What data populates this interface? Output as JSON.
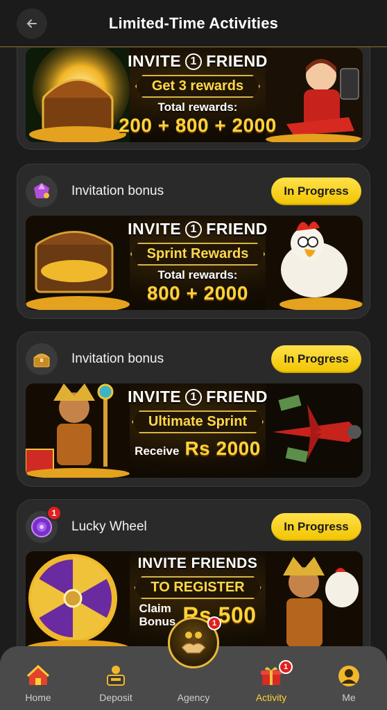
{
  "header": {
    "title": "Limited-Time Activities",
    "back_icon": "arrow-left-icon"
  },
  "cards": [
    {
      "banner": {
        "invite": "INVITE",
        "number": "1",
        "friend": "FRIEND",
        "pill": "Get 3 rewards",
        "total_label": "Total rewards:",
        "total_value": "200 + 800 + 2000"
      }
    },
    {
      "title": "Invitation bonus",
      "status": "In Progress",
      "icon": "gem-gift-icon",
      "banner": {
        "invite": "INVITE",
        "number": "1",
        "friend": "FRIEND",
        "pill": "Sprint Rewards",
        "total_label": "Total rewards:",
        "total_value": "800 + 2000"
      }
    },
    {
      "title": "Invitation bonus",
      "status": "In Progress",
      "icon": "treasure-chest-icon",
      "banner": {
        "invite": "INVITE",
        "number": "1",
        "friend": "FRIEND",
        "pill": "Ultimate Sprint",
        "receive_label": "Receive",
        "receive_value": "Rs 2000"
      }
    },
    {
      "title": "Lucky Wheel",
      "status": "In Progress",
      "icon": "wheel-icon",
      "badge": "1",
      "banner": {
        "line1": "INVITE FRIENDS",
        "pill": "TO REGISTER",
        "claim_label_1": "Claim",
        "claim_label_2": "Bonus",
        "claim_value": "Rs 500"
      }
    }
  ],
  "nav": {
    "items": [
      {
        "label": "Home",
        "icon": "home-icon"
      },
      {
        "label": "Deposit",
        "icon": "deposit-icon"
      },
      {
        "label": "Agency",
        "icon": "handshake-icon",
        "badge": "1"
      },
      {
        "label": "Activity",
        "icon": "gift-icon",
        "badge": "1",
        "active": true
      },
      {
        "label": "Me",
        "icon": "avatar-icon"
      }
    ]
  },
  "colors": {
    "accent": "#ffd233",
    "button": "#f1c400",
    "badge": "#e0201f",
    "background": "#1c1c1c"
  }
}
